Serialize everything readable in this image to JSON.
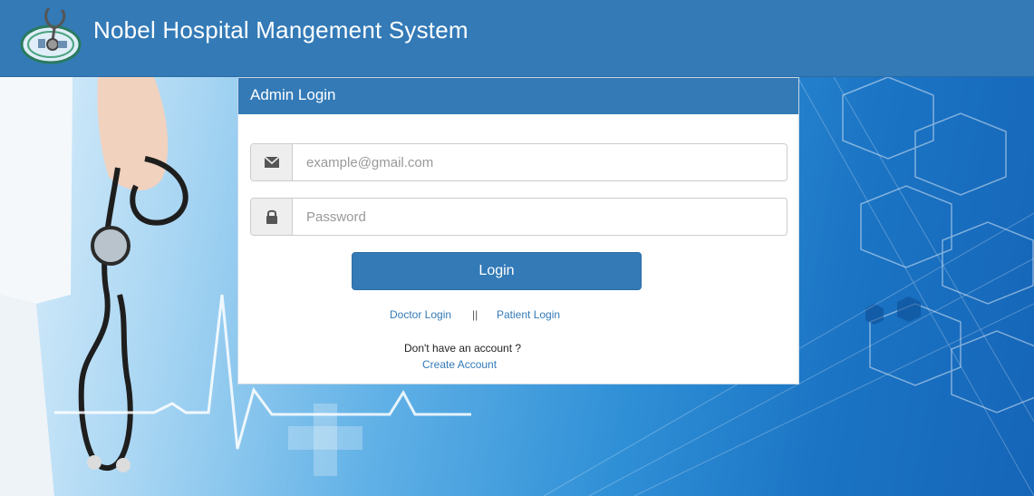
{
  "header": {
    "title": "Nobel Hospital Mangement System",
    "logo_icon": "stethoscope-logo-icon"
  },
  "panel": {
    "heading": "Admin Login",
    "email": {
      "icon": "envelope-icon",
      "placeholder": "example@gmail.com",
      "value": ""
    },
    "password": {
      "icon": "lock-icon",
      "placeholder": "Password",
      "value": ""
    },
    "login_label": "Login",
    "doctor_login": "Doctor Login",
    "separator": "||",
    "patient_login": "Patient Login",
    "no_account": "Don't have an account ?",
    "create_account": "Create Account"
  },
  "colors": {
    "primary": "#337ab7",
    "addon_bg": "#eeeeee"
  }
}
